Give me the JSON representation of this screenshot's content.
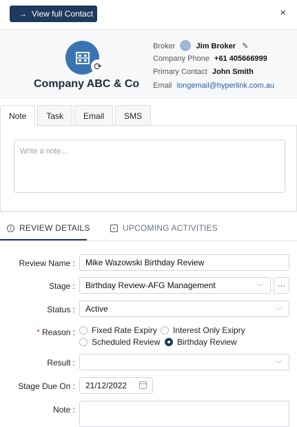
{
  "header": {
    "view_contact_label": "View full Contact",
    "close_label": "×"
  },
  "contact": {
    "company_name": "Company ABC & Co",
    "broker_label": "Broker",
    "broker_name": "Jim Broker",
    "phone_label": "Company Phone",
    "phone_value": "+61 405666999",
    "primary_label": "Primary Contact",
    "primary_value": "John Smith",
    "email_label": "Email",
    "email_value": "longemail@hyperlink.com.au"
  },
  "tabs": [
    {
      "label": "Note",
      "active": true
    },
    {
      "label": "Task",
      "active": false
    },
    {
      "label": "Email",
      "active": false
    },
    {
      "label": "SMS",
      "active": false
    }
  ],
  "note_panel": {
    "placeholder": "Write a note..."
  },
  "section_tabs": {
    "review": "REVIEW DETAILS",
    "upcoming": "UPCOMING ACTIVITIES"
  },
  "form": {
    "review_name_label": "Review Name",
    "review_name_value": "Mike Wazowski Birthday Review",
    "stage_label": "Stage",
    "stage_value": "Birthday Review-AFG Management",
    "more_label": "···",
    "status_label": "Status",
    "status_value": "Active",
    "reason_label": "Reason",
    "reason_options": [
      {
        "label": "Fixed Rate Expiry",
        "selected": false
      },
      {
        "label": "Interest Only Exipry",
        "selected": false
      },
      {
        "label": "Scheduled Review",
        "selected": false
      },
      {
        "label": "Birthday Review",
        "selected": true
      }
    ],
    "result_label": "Result",
    "result_value": "",
    "stage_due_label": "Stage Due On",
    "stage_due_value": "21/12/2022",
    "note_label": "Note"
  },
  "colors": {
    "primary": "#1e3a5f",
    "link": "#2563a8",
    "logo": "#3a74b0",
    "required": "#d9363e"
  }
}
